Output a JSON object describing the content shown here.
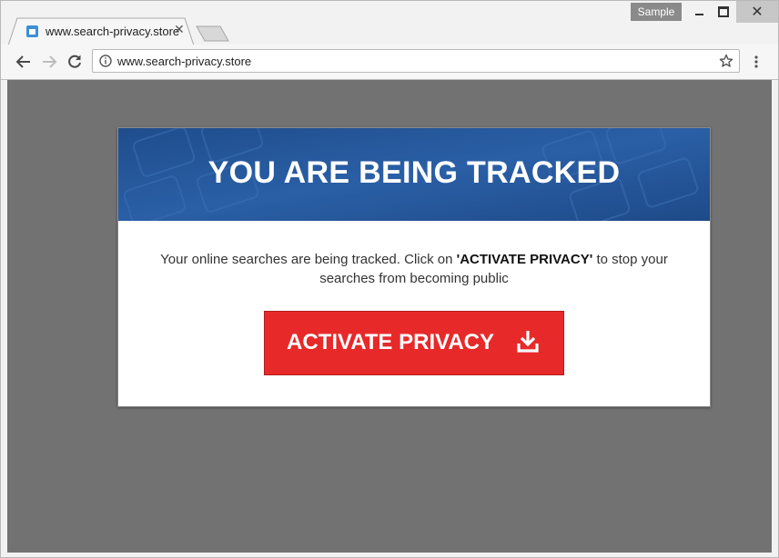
{
  "browser": {
    "profile_badge": "Sample",
    "tab": {
      "title": "www.search-privacy.store"
    },
    "address_bar": {
      "url": "www.search-privacy.store"
    }
  },
  "page": {
    "heading": "YOU ARE BEING TRACKED",
    "message_part1": "Your online searches are being tracked. Click on ",
    "message_emphasis": "'ACTIVATE PRIVACY'",
    "message_part2": " to stop your searches from becoming public",
    "button_label": "ACTIVATE PRIVACY"
  },
  "colors": {
    "header_blue": "#24569a",
    "button_red": "#e8292a",
    "page_backdrop": "#727272"
  },
  "icons": {
    "favicon": "home-favicon-icon",
    "back": "arrow-left-icon",
    "forward": "arrow-right-icon",
    "reload": "reload-icon",
    "info": "info-icon",
    "bookmark": "star-icon",
    "menu": "three-dots-vertical-icon",
    "download": "download-icon"
  }
}
